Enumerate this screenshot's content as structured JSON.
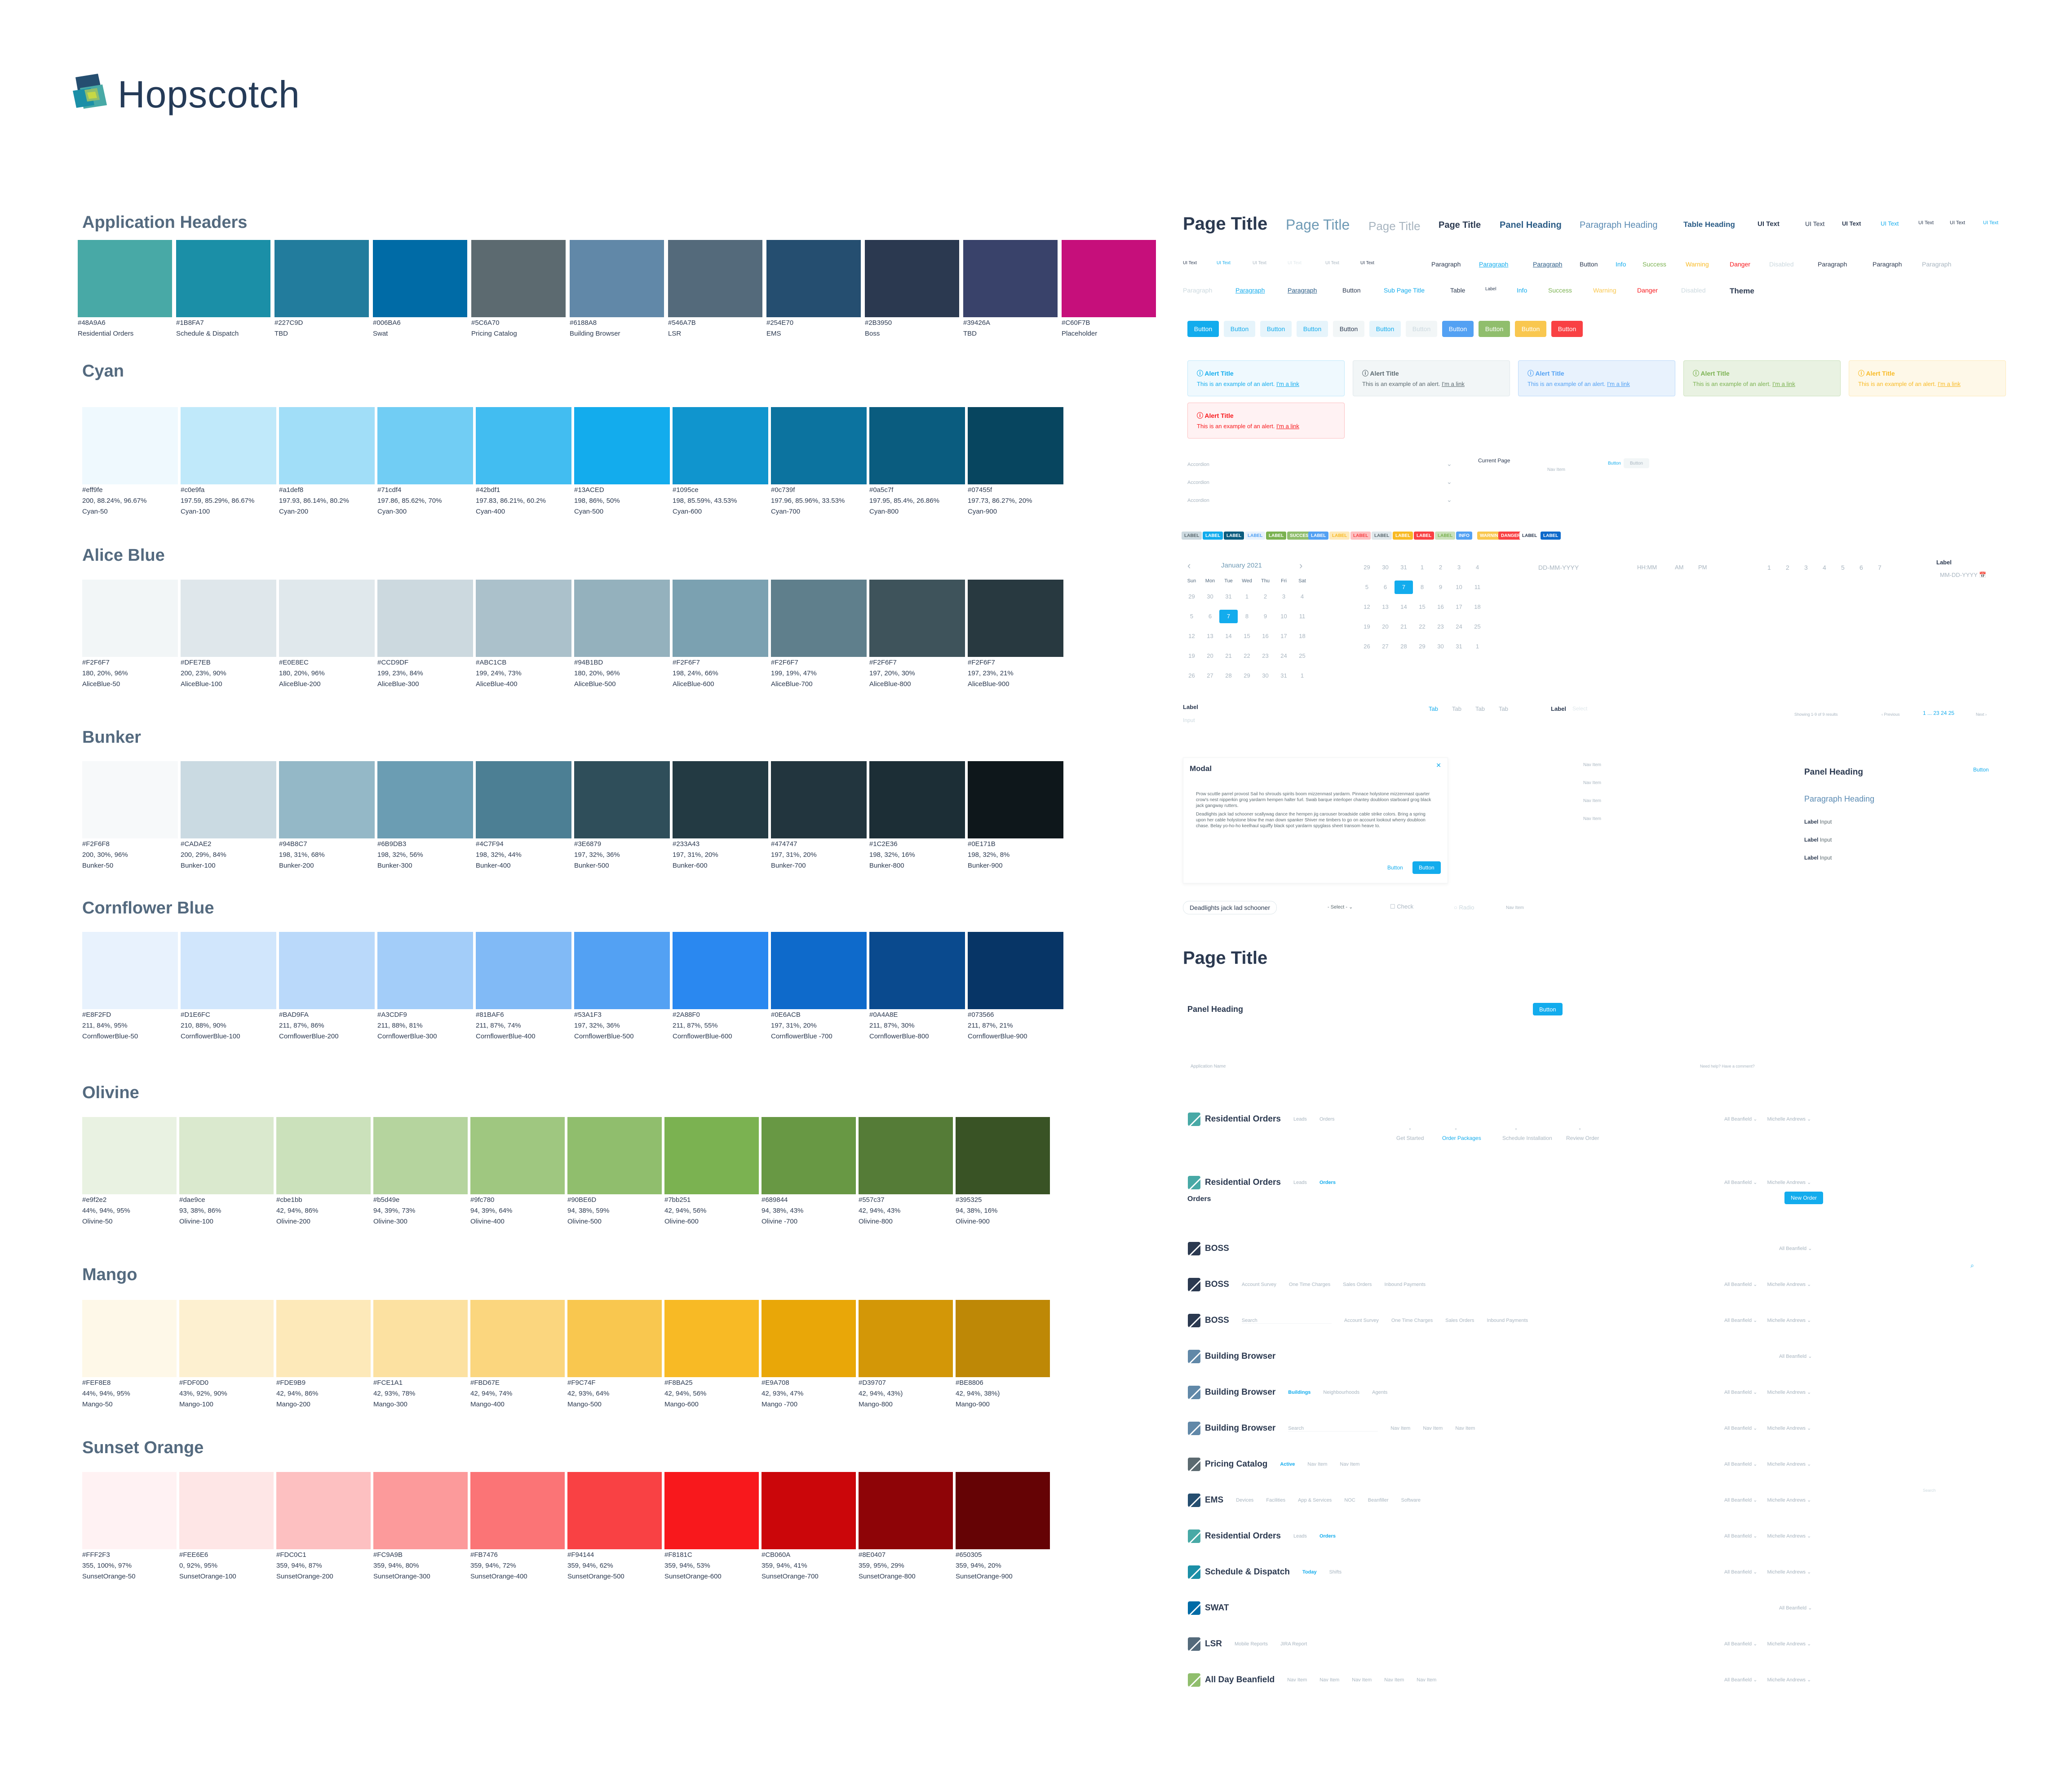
{
  "brand": {
    "name": "Hopscotch"
  },
  "app_headers": {
    "title": "Application Headers",
    "items": [
      {
        "hex": "#48A9A6",
        "name": "Residential Orders"
      },
      {
        "hex": "#1B8FA7",
        "name": "Schedule & Dispatch"
      },
      {
        "hex": "#227C9D",
        "name": "TBD"
      },
      {
        "hex": "#006BA6",
        "name": "Swat"
      },
      {
        "hex": "#5C6A70",
        "name": "Pricing Catalog"
      },
      {
        "hex": "#6188A8",
        "name": "Building Browser"
      },
      {
        "hex": "#546A7B",
        "name": "LSR"
      },
      {
        "hex": "#254E70",
        "name": "EMS"
      },
      {
        "hex": "#2B3950",
        "name": "Boss"
      },
      {
        "hex": "#39426A",
        "name": "TBD"
      },
      {
        "hex": "#C60F7B",
        "name": "Placeholder"
      }
    ]
  },
  "palettes": [
    {
      "title": "Cyan",
      "items": [
        {
          "hex": "#eff9fe",
          "vals": "200, 88.24%, 96.67%",
          "name": "Cyan-50"
        },
        {
          "hex": "#c0e9fa",
          "vals": "197.59, 85.29%, 86.67%",
          "name": "Cyan-100"
        },
        {
          "hex": "#a1def8",
          "vals": "197.93, 86.14%, 80.2%",
          "name": "Cyan-200"
        },
        {
          "hex": "#71cdf4",
          "vals": "197.86, 85.62%, 70%",
          "name": "Cyan-300"
        },
        {
          "hex": "#42bdf1",
          "vals": "197.83, 86.21%, 60.2%",
          "name": "Cyan-400"
        },
        {
          "hex": "#13ACED",
          "vals": "198, 86%, 50%",
          "name": "Cyan-500"
        },
        {
          "hex": "#1095ce",
          "vals": "198, 85.59%, 43.53%",
          "name": "Cyan-600"
        },
        {
          "hex": "#0c739f",
          "vals": "197.96, 85.96%, 33.53%",
          "name": "Cyan-700"
        },
        {
          "hex": "#0a5c7f",
          "vals": "197.95, 85.4%, 26.86%",
          "name": "Cyan-800"
        },
        {
          "hex": "#07455f",
          "vals": "197.73, 86.27%, 20%",
          "name": "Cyan-900"
        }
      ]
    },
    {
      "title": "Alice Blue",
      "items": [
        {
          "hex": "#F2F6F7",
          "vals": "180, 20%, 96%",
          "name": "AliceBlue-50"
        },
        {
          "hex": "#DFE7EB",
          "vals": "200, 23%, 90%",
          "name": "AliceBlue-100"
        },
        {
          "hex": "#E0E8EC",
          "vals": "180, 20%, 96%",
          "name": "AliceBlue-200"
        },
        {
          "hex": "#CCD9DF",
          "vals": "199, 23%, 84%",
          "name": "AliceBlue-300"
        },
        {
          "hex": "#ABC1CB",
          "vals": "199, 24%, 73%",
          "name": "AliceBlue-400"
        },
        {
          "hex": "#94B1BD",
          "vals": "180, 20%, 96%",
          "name": "AliceBlue-500"
        },
        {
          "hex": "#F2F6F7",
          "vals": "198, 24%, 66%",
          "name": "AliceBlue-600"
        },
        {
          "hex": "#F2F6F7",
          "vals": "199, 19%, 47%",
          "name": "AliceBlue-700"
        },
        {
          "hex": "#F2F6F7",
          "vals": "197, 20%, 30%",
          "name": "AliceBlue-800"
        },
        {
          "hex": "#F2F6F7",
          "vals": "197, 23%, 21%",
          "name": "AliceBlue-900"
        }
      ],
      "chips": [
        "#F2F6F7",
        "#DFE7EB",
        "#E0E8EC",
        "#CCD9DF",
        "#ABC1CB",
        "#94B1BD",
        "#7BA1B1",
        "#5F7F8C",
        "#3E535B",
        "#283940"
      ]
    },
    {
      "title": "Bunker",
      "items": [
        {
          "hex": "#F2F6F8",
          "vals": "200, 30%, 96%",
          "name": "Bunker-50"
        },
        {
          "hex": "#CADAE2",
          "vals": "200, 29%, 84%",
          "name": "Bunker-100"
        },
        {
          "hex": "#94B8C7",
          "vals": "198, 31%, 68%",
          "name": "Bunker-200"
        },
        {
          "hex": "#6B9DB3",
          "vals": "198, 32%, 56%",
          "name": "Bunker-300"
        },
        {
          "hex": "#4C7F94",
          "vals": "198, 32%, 44%",
          "name": "Bunker-400"
        },
        {
          "hex": "#3E6879",
          "vals": "197, 32%, 36%",
          "name": "Bunker-500"
        },
        {
          "hex": "#233A43",
          "vals": "197, 31%, 20%",
          "name": "Bunker-600"
        },
        {
          "hex": "#474747",
          "vals": "197, 31%, 20%",
          "name": "Bunker-700"
        },
        {
          "hex": "#1C2E36",
          "vals": "198, 32%, 16%",
          "name": "Bunker-800"
        },
        {
          "hex": "#0E171B",
          "vals": "198, 32%, 8%",
          "name": "Bunker-900"
        }
      ],
      "chips": [
        "#F7F9FA",
        "#CADAE2",
        "#94B8C7",
        "#6B9DB3",
        "#4C7F94",
        "#2F4E5A",
        "#233A43",
        "#22353E",
        "#1C2E36",
        "#0E171B"
      ]
    },
    {
      "title": "Cornflower Blue",
      "items": [
        {
          "hex": "#E8F2FD",
          "vals": "211, 84%, 95%",
          "name": "CornflowerBlue-50"
        },
        {
          "hex": "#D1E6FC",
          "vals": "210, 88%, 90%",
          "name": "CornflowerBlue-100"
        },
        {
          "hex": "#BAD9FA",
          "vals": "211, 87%, 86%",
          "name": "CornflowerBlue-200"
        },
        {
          "hex": "#A3CDF9",
          "vals": "211, 88%, 81%",
          "name": "CornflowerBlue-300"
        },
        {
          "hex": "#81BAF6",
          "vals": "211, 87%, 74%",
          "name": "CornflowerBlue-400"
        },
        {
          "hex": "#53A1F3",
          "vals": "197, 32%, 36%",
          "name": "CornflowerBlue-500"
        },
        {
          "hex": "#2A88F0",
          "vals": "211, 87%, 55%",
          "name": "CornflowerBlue-600"
        },
        {
          "hex": "#0E6ACB",
          "vals": "197, 31%, 20%",
          "name": "CornflowerBlue -700"
        },
        {
          "hex": "#0A4A8E",
          "vals": "211, 87%, 30%",
          "name": "CornflowerBlue-800"
        },
        {
          "hex": "#073566",
          "vals": "211, 87%, 21%",
          "name": "CornflowerBlue-900"
        }
      ]
    },
    {
      "title": "Olivine",
      "items": [
        {
          "hex": "#e9f2e2",
          "vals": "44%, 94%, 95%",
          "name": "Olivine-50"
        },
        {
          "hex": "#dae9ce",
          "vals": "93, 38%, 86%",
          "name": "Olivine-100"
        },
        {
          "hex": "#cbe1bb",
          "vals": "42, 94%, 86%",
          "name": "Olivine-200"
        },
        {
          "hex": "#b5d49e",
          "vals": "94, 39%, 73%",
          "name": "Olivine-300"
        },
        {
          "hex": "#9fc780",
          "vals": "94, 39%, 64%",
          "name": "Olivine-400"
        },
        {
          "hex": "#90BE6D",
          "vals": "94, 38%, 59%",
          "name": "Olivine-500"
        },
        {
          "hex": "#7bb251",
          "vals": "42, 94%, 56%",
          "name": "Olivine-600"
        },
        {
          "hex": "#689844",
          "vals": "94, 38%, 43%",
          "name": "Olivine -700"
        },
        {
          "hex": "#557c37",
          "vals": "42, 94%, 43%",
          "name": "Olivine-800"
        },
        {
          "hex": "#395325",
          "vals": "94, 38%, 16%",
          "name": "Olivine-900"
        }
      ]
    },
    {
      "title": "Mango",
      "items": [
        {
          "hex": "#FEF8E8",
          "vals": "44%, 94%, 95%",
          "name": "Mango-50"
        },
        {
          "hex": "#FDF0D0",
          "vals": "43%, 92%, 90%",
          "name": "Mango-100"
        },
        {
          "hex": "#FDE9B9",
          "vals": "42, 94%, 86%",
          "name": "Mango-200"
        },
        {
          "hex": "#FCE1A1",
          "vals": "42, 93%, 78%",
          "name": "Mango-300"
        },
        {
          "hex": "#FBD67E",
          "vals": "42, 94%, 74%",
          "name": "Mango-400"
        },
        {
          "hex": "#F9C74F",
          "vals": "42, 93%, 64%",
          "name": "Mango-500"
        },
        {
          "hex": "#F8BA25",
          "vals": "42, 94%, 56%",
          "name": "Mango-600"
        },
        {
          "hex": "#E9A708",
          "vals": "42, 93%, 47%",
          "name": "Mango -700"
        },
        {
          "hex": "#D39707",
          "vals": "42, 94%, 43%)",
          "name": "Mango-800"
        },
        {
          "hex": "#BE8806",
          "vals": "42, 94%, 38%)",
          "name": "Mango-900"
        }
      ]
    },
    {
      "title": "Sunset Orange",
      "items": [
        {
          "hex": "#FFF2F3",
          "vals": "355, 100%, 97%",
          "name": "SunsetOrange-50"
        },
        {
          "hex": "#FEE6E6",
          "vals": "0, 92%, 95%",
          "name": "SunsetOrange-100"
        },
        {
          "hex": "#FDC0C1",
          "vals": "359, 94%, 87%",
          "name": "SunsetOrange-200"
        },
        {
          "hex": "#FC9A9B",
          "vals": "359, 94%, 80%",
          "name": "SunsetOrange-300"
        },
        {
          "hex": "#FB7476",
          "vals": "359, 94%, 72%",
          "name": "SunsetOrange-400"
        },
        {
          "hex": "#F94144",
          "vals": "359, 94%, 62%",
          "name": "SunsetOrange-500"
        },
        {
          "hex": "#F8181C",
          "vals": "359, 94%, 53%",
          "name": "SunsetOrange-600"
        },
        {
          "hex": "#CB060A",
          "vals": "359, 94%, 41%",
          "name": "SunsetOrange-700"
        },
        {
          "hex": "#8E0407",
          "vals": "359, 95%, 29%",
          "name": "SunsetOrange-800"
        },
        {
          "hex": "#650305",
          "vals": "359, 94%, 20%",
          "name": "SunsetOrange-900"
        }
      ]
    }
  ],
  "typography": {
    "row1": [
      "Page Title",
      "Page Title",
      "Page Title",
      "Page Title",
      "Panel Heading",
      "Paragraph Heading",
      "Table Heading",
      "UI Text",
      "UI Text",
      "UI Text",
      "UI Text",
      "UI Text",
      "UI Text",
      "UI Text"
    ],
    "row2": [
      "UI Text",
      "UI Text",
      "UI Text",
      "UI Text",
      "UI Text",
      "UI Text",
      "Paragraph",
      "Paragraph",
      "Paragraph",
      "Button",
      "Info",
      "Success",
      "Warning",
      "Danger",
      "Disabled",
      "Paragraph",
      "Paragraph",
      "Paragraph"
    ],
    "row3": [
      "Paragraph",
      "Paragraph",
      "Paragraph",
      "Button",
      "Sub Page Title",
      "Table",
      "Label",
      "Info",
      "Success",
      "Warning",
      "Danger",
      "Disabled",
      "Theme"
    ]
  },
  "buttons": [
    "Button",
    "Button",
    "Button",
    "Button",
    "Button",
    "Button",
    "Button",
    "Button",
    "Button",
    "Button",
    "Button"
  ],
  "alerts": {
    "title": "Alert Title",
    "body": "This is an example of an alert.",
    "link": "I'm a link"
  },
  "forms": {
    "accordion": "Accordion",
    "current_page": "Current Page",
    "nav_item": "Nav Item",
    "btn": "Button"
  },
  "labels": [
    "LABEL",
    "LABEL",
    "LABEL",
    "LABEL",
    "LABEL",
    "SUCCESS",
    "LABEL",
    "LABEL",
    "LABEL",
    "LABEL",
    "LABEL",
    "LABEL",
    "LABEL",
    "INFO",
    "WARNING",
    "DANGER",
    "LABEL",
    "LABEL"
  ],
  "calendar": {
    "month": "January 2021",
    "days": [
      "Sun",
      "Mon",
      "Tue",
      "Wed",
      "Thu",
      "Fri",
      "Sat"
    ],
    "grid": [
      "29",
      "30",
      "31",
      "1",
      "2",
      "3",
      "4",
      "5",
      "6",
      "7",
      "8",
      "9",
      "10",
      "11",
      "12",
      "13",
      "14",
      "15",
      "16",
      "17",
      "18",
      "19",
      "20",
      "21",
      "22",
      "23",
      "24",
      "25",
      "26",
      "27",
      "28",
      "29",
      "30",
      "31",
      "1"
    ],
    "grid2": [
      "29",
      "30",
      "31",
      "1",
      "2",
      "3",
      "4",
      "5",
      "6",
      "7",
      "8",
      "9",
      "10",
      "11",
      "12",
      "13",
      "14",
      "15",
      "16",
      "17",
      "18",
      "19",
      "20",
      "21",
      "22",
      "23",
      "24",
      "25",
      "26",
      "27",
      "28",
      "29",
      "30",
      "31",
      "1"
    ],
    "date_fmt": "DD-MM-YYYY",
    "time_fmt": "HH:MM",
    "am": "AM",
    "pm": "PM",
    "pages": [
      "1",
      "2",
      "3",
      "4",
      "5",
      "6",
      "7"
    ],
    "label": "Label",
    "date_ph": "MM-DD-YYYY"
  },
  "tabs": {
    "label": "Label",
    "items": [
      "Tab",
      "Tab",
      "Tab",
      "Tab"
    ],
    "label2": "Label",
    "showing": "Showing 1-9 of 9 results",
    "prev": "Previous",
    "pages": "1 ... 23 24 25",
    "next": "Next"
  },
  "modal": {
    "title": "Modal",
    "p1": "Prow scuttle parrel provost Sail ho shrouds spirits boom mizzenmast yardarm. Pinnace holystone mizzenmast quarter crow's nest nipperkin grog yardarm hempen halter furl. Swab barque interloper chantey doubloon starboard grog black jack gangway rutters.",
    "p2": "Deadlights jack lad schooner scallywag dance the hempen jig carouser broadside cable strike colors. Bring a spring upon her cable holystone blow the man down spanker Shiver me timbers to go on account lookout wherry doubloon chase. Belay yo-ho-ho keelhaul squiffy black spot yardarm spyglass sheet transom heave to.",
    "cancel": "Button",
    "ok": "Button"
  },
  "side_panel": {
    "heading": "Panel Heading",
    "btn": "Button",
    "para": "Paragraph Heading",
    "labels": [
      "Label",
      "Label",
      "Label"
    ],
    "inputs": [
      "Input",
      "Input",
      "Input"
    ]
  },
  "misc": {
    "chip": "Deadlights jack lad schooner",
    "select": "- Select -",
    "check": "Check",
    "radio": "Radio",
    "nav_item": "Nav Item"
  },
  "page2": {
    "title": "Page Title",
    "panel_heading": "Panel Heading",
    "btn": "Button",
    "app_name": "Application Name",
    "help": "Need help? Have a comment?"
  },
  "steps": [
    "Get Started",
    "Order Packages",
    "Schedule Installation",
    "Review Order"
  ],
  "orders": {
    "title": "Orders",
    "new_btn": "New Order"
  },
  "apps": [
    {
      "name": "Residential Orders",
      "color": "#48A9A6",
      "subs": [
        "Leads",
        "Orders"
      ],
      "active": -1,
      "right": [
        "All Beanfield",
        "Michelle Andrews"
      ]
    },
    {
      "name": "Residential Orders",
      "color": "#48A9A6",
      "subs": [
        "Leads",
        "Orders"
      ],
      "active": 1,
      "right": [
        "All Beanfield",
        "Michelle Andrews"
      ]
    },
    {
      "name": "BOSS",
      "color": "#2B3950",
      "subs": [],
      "active": -1,
      "right": [
        "All Beanfield"
      ]
    },
    {
      "name": "BOSS",
      "color": "#2B3950",
      "subs": [
        "Account Survey",
        "One Time Charges",
        "Sales Orders",
        "Inbound Payments"
      ],
      "active": -1,
      "right": [
        "All Beanfield",
        "Michelle Andrews"
      ]
    },
    {
      "name": "BOSS",
      "color": "#2B3950",
      "subs": [
        "Search",
        "Account Survey",
        "One Time Charges",
        "Sales Orders",
        "Inbound Payments"
      ],
      "active": -1,
      "right": [
        "All Beanfield",
        "Michelle Andrews"
      ]
    },
    {
      "name": "Building Browser",
      "color": "#6188A8",
      "subs": [],
      "active": -1,
      "right": [
        "All Beanfield"
      ]
    },
    {
      "name": "Building Browser",
      "color": "#6188A8",
      "subs": [
        "Buildings",
        "Neighbourhoods",
        "Agents"
      ],
      "active": 0,
      "right": [
        "All Beanfield",
        "Michelle Andrews"
      ]
    },
    {
      "name": "Building Browser",
      "color": "#6188A8",
      "subs": [
        "Search",
        "Nav Item",
        "Nav Item",
        "Nav Item"
      ],
      "active": -1,
      "right": [
        "All Beanfield",
        "Michelle Andrews"
      ]
    },
    {
      "name": "Pricing Catalog",
      "color": "#5C6A70",
      "subs": [
        "Active",
        "Nav Item",
        "Nav Item"
      ],
      "active": 0,
      "right": [
        "All Beanfield",
        "Michelle Andrews"
      ]
    },
    {
      "name": "EMS",
      "color": "#254E70",
      "subs": [
        "Devices",
        "Facilities",
        "App & Services",
        "NOC",
        "Beanfiller",
        "Software"
      ],
      "active": -1,
      "right": [
        "All Beanfield",
        "Michelle Andrews"
      ]
    },
    {
      "name": "Residential Orders",
      "color": "#48A9A6",
      "subs": [
        "Leads",
        "Orders"
      ],
      "active": 1,
      "right": [
        "All Beanfield",
        "Michelle Andrews"
      ]
    },
    {
      "name": "Schedule & Dispatch",
      "color": "#1B8FA7",
      "subs": [
        "Today",
        "Shifts"
      ],
      "active": 0,
      "right": [
        "All Beanfield",
        "Michelle Andrews"
      ]
    },
    {
      "name": "SWAT",
      "color": "#006BA6",
      "subs": [],
      "active": -1,
      "right": [
        "All Beanfield"
      ]
    },
    {
      "name": "LSR",
      "color": "#546A7B",
      "subs": [
        "Mobile Reports",
        "JIRA Report"
      ],
      "active": -1,
      "right": [
        "All Beanfield",
        "Michelle Andrews"
      ]
    },
    {
      "name": "All Day Beanfield",
      "color": "#90BE6D",
      "subs": [
        "Nav Item",
        "Nav Item",
        "Nav Item",
        "Nav Item",
        "Nav Item"
      ],
      "active": -1,
      "right": [
        "All Beanfield",
        "Michelle Andrews"
      ]
    }
  ],
  "search_ph": "Search"
}
